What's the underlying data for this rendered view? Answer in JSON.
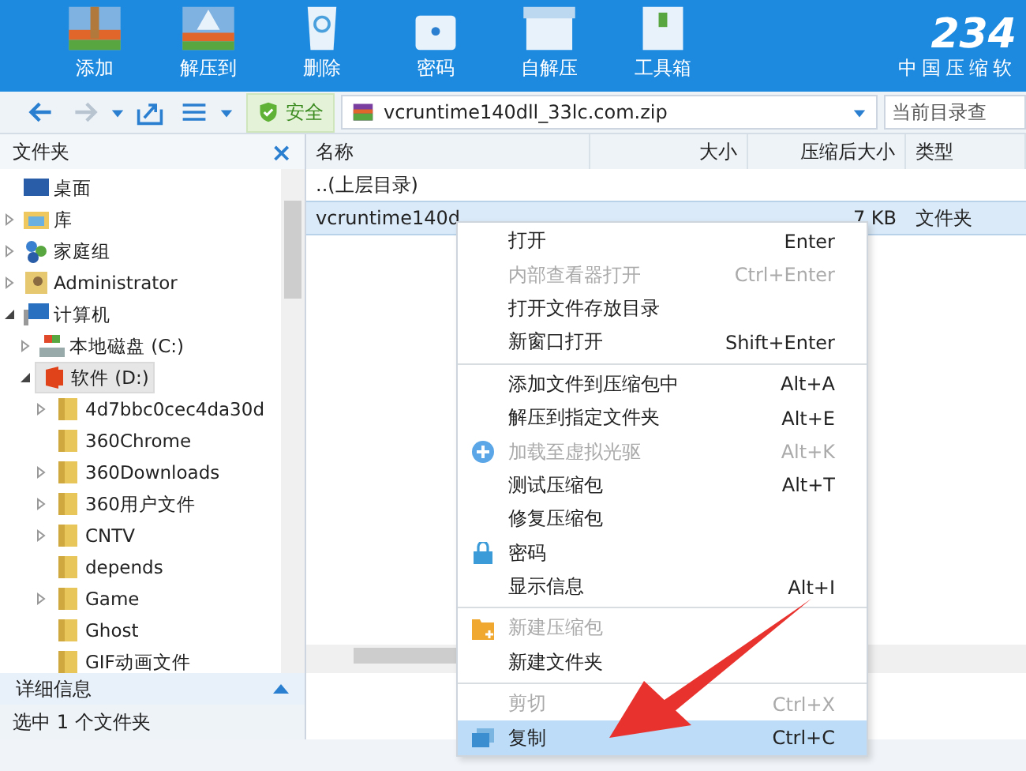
{
  "toolbar": {
    "buttons": [
      {
        "label": "添加"
      },
      {
        "label": "解压到"
      },
      {
        "label": "删除"
      },
      {
        "label": "密码"
      },
      {
        "label": "自解压"
      },
      {
        "label": "工具箱"
      }
    ],
    "logo": {
      "number": "234",
      "slogan": "中国压缩软"
    }
  },
  "navbar": {
    "safety": "安全",
    "path": "vcruntime140dll_33lc.com.zip",
    "search_placeholder": "当前目录查"
  },
  "sidebar": {
    "title": "文件夹",
    "close": "×",
    "tree": [
      {
        "label": "桌面",
        "selected": false
      },
      {
        "label": "库",
        "expanded": false,
        "selected": false
      },
      {
        "label": "家庭组",
        "expanded": false,
        "selected": false
      },
      {
        "label": "Administrator",
        "expanded": false,
        "selected": false
      },
      {
        "label": "计算机",
        "expanded": true,
        "selected": false,
        "children": [
          {
            "label": "本地磁盘 (C:)",
            "expanded": false,
            "selected": false
          },
          {
            "label": "软件 (D:)",
            "expanded": true,
            "selected": true,
            "children": [
              {
                "label": "4d7bbc0cec4da30d",
                "expanded": false,
                "selected": false
              },
              {
                "label": "360Chrome",
                "selected": false
              },
              {
                "label": "360Downloads",
                "expanded": false,
                "selected": false
              },
              {
                "label": "360用户文件",
                "expanded": false,
                "selected": false
              },
              {
                "label": "CNTV",
                "expanded": false,
                "selected": false
              },
              {
                "label": "depends",
                "selected": false
              },
              {
                "label": "Game",
                "expanded": false,
                "selected": false
              },
              {
                "label": "Ghost",
                "selected": false
              },
              {
                "label": "GIF动画文件",
                "selected": false
              }
            ]
          }
        ]
      }
    ],
    "details": "详细信息"
  },
  "table": {
    "columns": [
      "名称",
      "大小",
      "压缩后大小",
      "类型"
    ],
    "rows": [
      {
        "name": "..(上层目录)",
        "selected": false
      },
      {
        "name": "vcruntime140d",
        "compressed_size": "7 KB",
        "type": "文件夹",
        "selected": true
      }
    ]
  },
  "status_bar": "选中 1 个文件夹",
  "context_menu": [
    {
      "kind": "item",
      "label": "打开",
      "shortcut": "Enter",
      "disabled": false,
      "selected": false
    },
    {
      "kind": "item",
      "label": "内部查看器打开",
      "shortcut": "Ctrl+Enter",
      "disabled": true,
      "selected": false
    },
    {
      "kind": "item",
      "label": "打开文件存放目录",
      "disabled": false,
      "selected": false
    },
    {
      "kind": "item",
      "label": "新窗口打开",
      "shortcut": "Shift+Enter",
      "disabled": false,
      "selected": false
    },
    {
      "kind": "separator"
    },
    {
      "kind": "item",
      "label": "添加文件到压缩包中",
      "shortcut": "Alt+A",
      "disabled": false,
      "selected": false
    },
    {
      "kind": "item",
      "label": "解压到指定文件夹",
      "shortcut": "Alt+E",
      "disabled": false,
      "selected": false
    },
    {
      "kind": "item",
      "label": "加载至虚拟光驱",
      "shortcut": "Alt+K",
      "disabled": true,
      "selected": false
    },
    {
      "kind": "item",
      "label": "测试压缩包",
      "shortcut": "Alt+T",
      "disabled": false,
      "selected": false
    },
    {
      "kind": "item",
      "label": "修复压缩包",
      "disabled": false,
      "selected": false
    },
    {
      "kind": "item",
      "label": "密码",
      "disabled": false,
      "selected": false
    },
    {
      "kind": "item",
      "label": "显示信息",
      "shortcut": "Alt+I",
      "disabled": false,
      "selected": false
    },
    {
      "kind": "separator"
    },
    {
      "kind": "item",
      "label": "新建压缩包",
      "disabled": true,
      "selected": false
    },
    {
      "kind": "item",
      "label": "新建文件夹",
      "disabled": false,
      "selected": false
    },
    {
      "kind": "separator"
    },
    {
      "kind": "item",
      "label": "剪切",
      "shortcut": "Ctrl+X",
      "disabled": true,
      "selected": false
    },
    {
      "kind": "item",
      "label": "复制",
      "shortcut": "Ctrl+C",
      "disabled": false,
      "selected": true
    }
  ]
}
